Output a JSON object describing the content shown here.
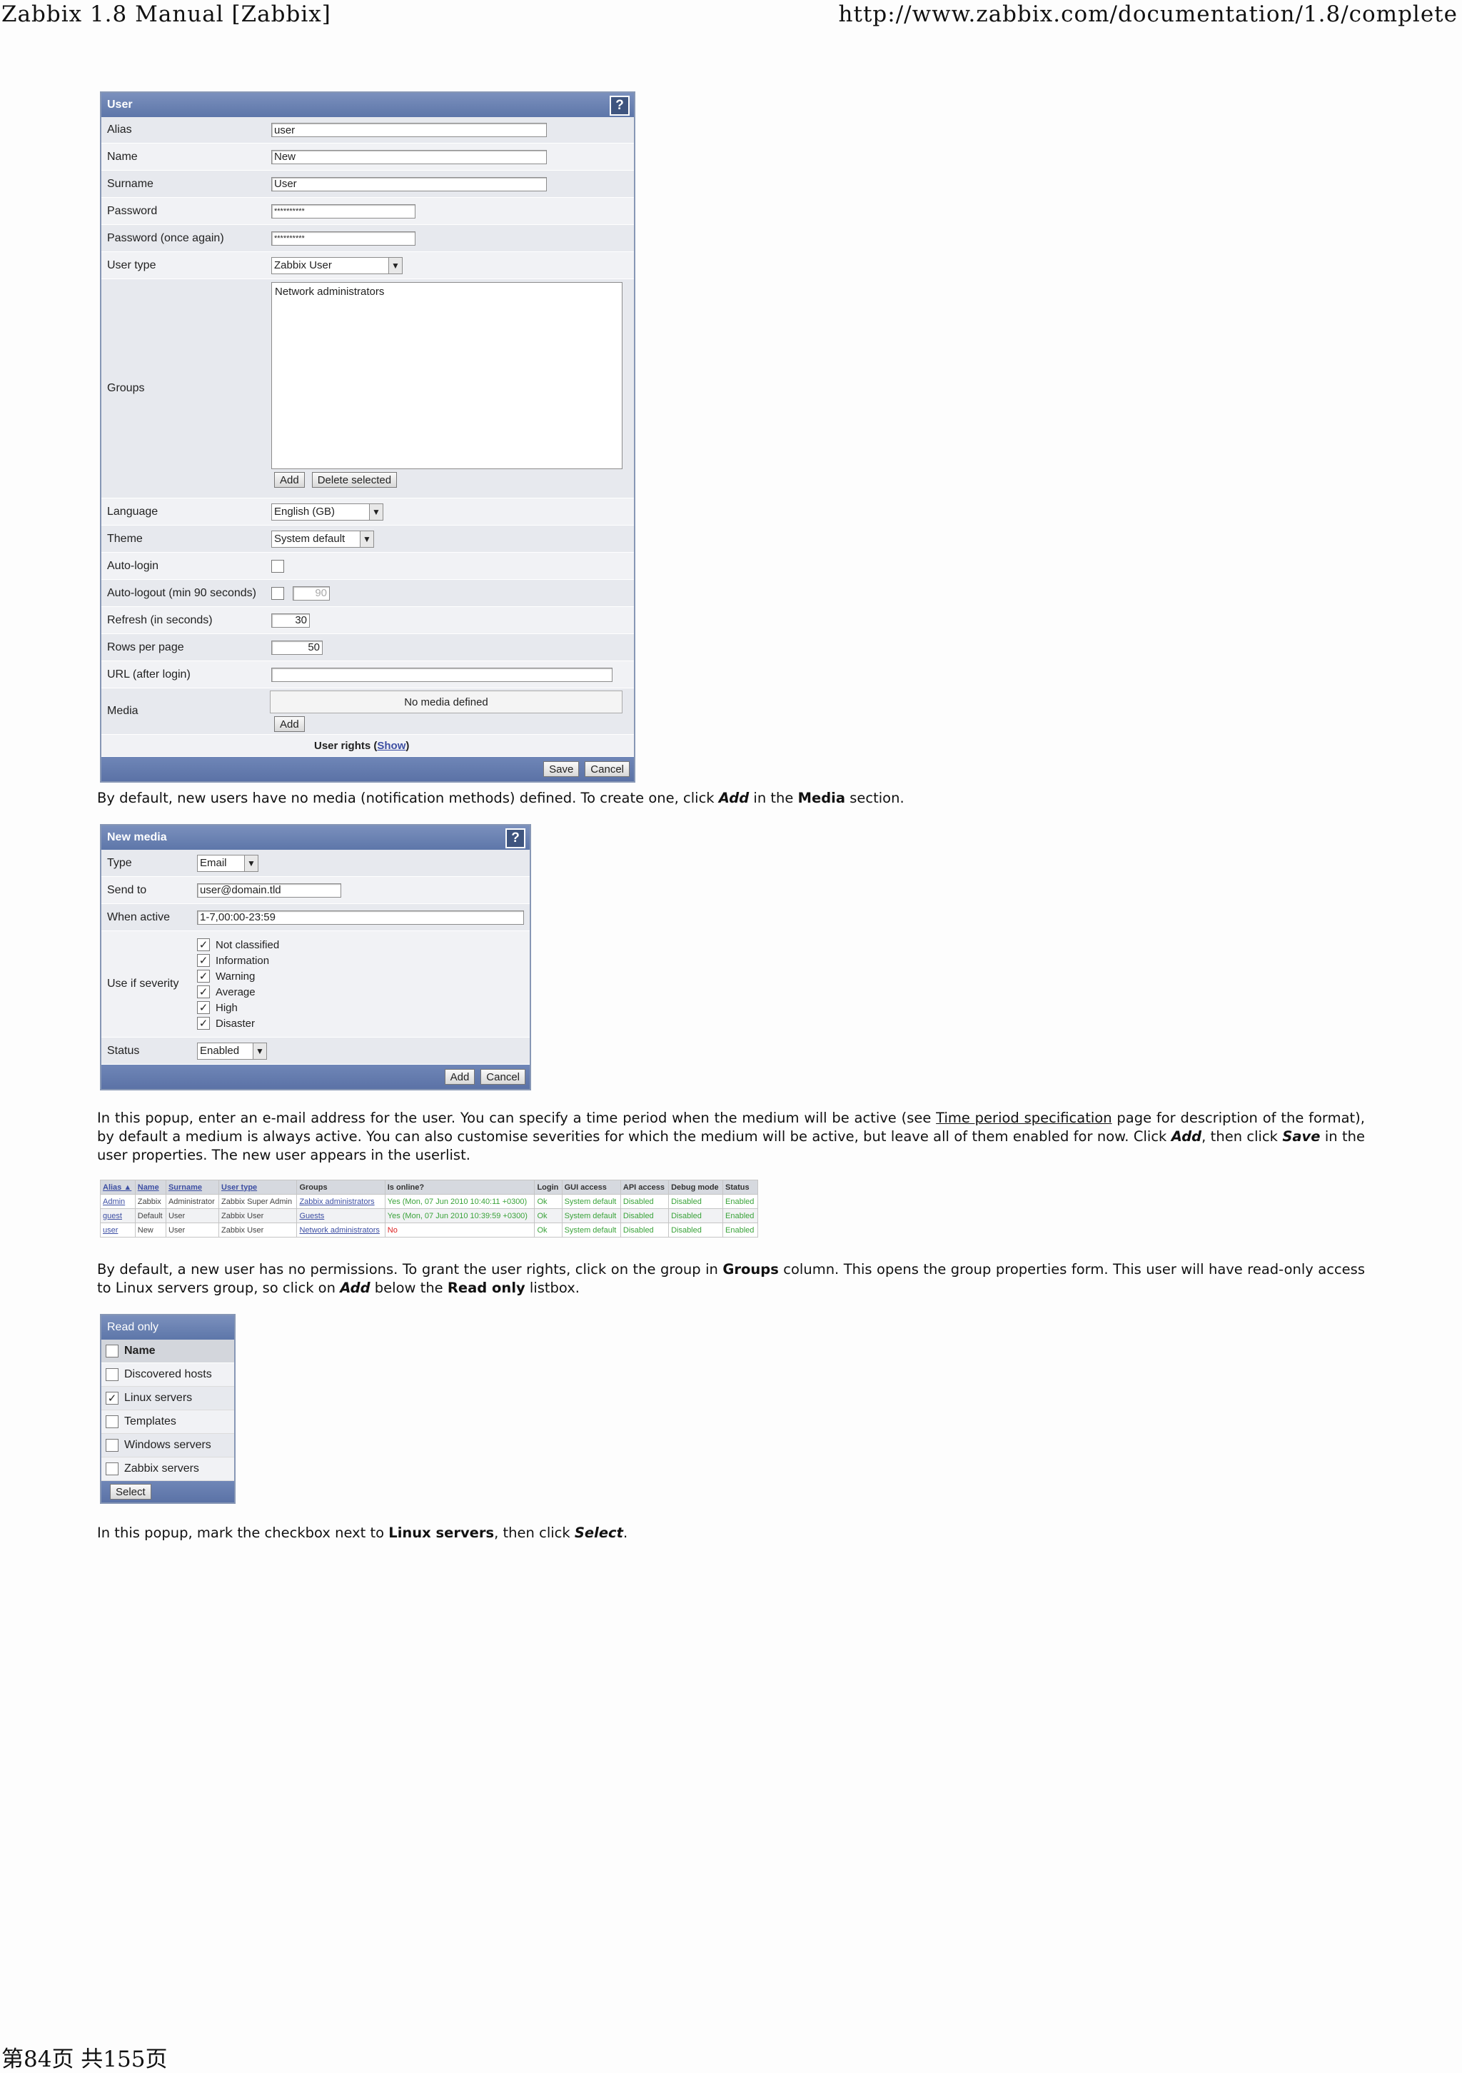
{
  "header": {
    "left": "Zabbix 1.8 Manual [Zabbix]",
    "right": "http://www.zabbix.com/documentation/1.8/complete"
  },
  "footer": "第84页 共155页",
  "user_form": {
    "title": "User",
    "alias_label": "Alias",
    "alias_value": "user",
    "name_label": "Name",
    "name_value": "New",
    "surname_label": "Surname",
    "surname_value": "User",
    "password_label": "Password",
    "password_value": "**********",
    "password2_label": "Password (once again)",
    "password2_value": "**********",
    "usertype_label": "User type",
    "usertype_value": "Zabbix User",
    "groups_label": "Groups",
    "groups_items": [
      "Network administrators"
    ],
    "add_btn": "Add",
    "delete_btn": "Delete selected",
    "language_label": "Language",
    "language_value": "English (GB)",
    "theme_label": "Theme",
    "theme_value": "System default",
    "autologin_label": "Auto-login",
    "autologout_label": "Auto-logout (min 90 seconds)",
    "autologout_value": "90",
    "refresh_label": "Refresh (in seconds)",
    "refresh_value": "30",
    "rows_label": "Rows per page",
    "rows_value": "50",
    "url_label": "URL (after login)",
    "url_value": "",
    "media_label": "Media",
    "media_none": "No media defined",
    "media_add": "Add",
    "rights_label": "User rights",
    "rights_link": "Show",
    "save_btn": "Save",
    "cancel_btn": "Cancel"
  },
  "para1": {
    "t1": "By default, new users have no media (notification methods) defined. To create one, click ",
    "b1": "Add",
    "t2": " in the ",
    "b2": "Media",
    "t3": " section."
  },
  "media_form": {
    "title": "New media",
    "type_label": "Type",
    "type_value": "Email",
    "sendto_label": "Send to",
    "sendto_value": "user@domain.tld",
    "active_label": "When active",
    "active_value": "1-7,00:00-23:59",
    "severity_label": "Use if severity",
    "severities": [
      "Not classified",
      "Information",
      "Warning",
      "Average",
      "High",
      "Disaster"
    ],
    "status_label": "Status",
    "status_value": "Enabled",
    "add_btn": "Add",
    "cancel_btn": "Cancel"
  },
  "para2": {
    "t1": "In this popup, enter an e-mail address for the user. You can specify a time period when the medium will be active (see ",
    "link": "Time period specification",
    "t2": " page for description of the format), by default a medium is always active. You can also customise severities for which the medium will be active, but leave all of them enabled for now. Click ",
    "b1": "Add",
    "t3": ", then click ",
    "b2": "Save",
    "t4": " in the user properties. The new user appears in the userlist."
  },
  "users_table": {
    "headers": [
      "Alias ▲",
      "Name",
      "Surname",
      "User type",
      "Groups",
      "Is online?",
      "Login",
      "GUI access",
      "API access",
      "Debug mode",
      "Status"
    ],
    "rows": [
      [
        "Admin",
        "Zabbix",
        "Administrator",
        "Zabbix Super Admin",
        "Zabbix administrators",
        "Yes (Mon, 07 Jun 2010 10:40:11 +0300)",
        "Ok",
        "System default",
        "Disabled",
        "Disabled",
        "Enabled"
      ],
      [
        "guest",
        "Default",
        "User",
        "Zabbix User",
        "Guests",
        "Yes (Mon, 07 Jun 2010 10:39:59 +0300)",
        "Ok",
        "System default",
        "Disabled",
        "Disabled",
        "Enabled"
      ],
      [
        "user",
        "New",
        "User",
        "Zabbix User",
        "Network administrators",
        "No",
        "Ok",
        "System default",
        "Disabled",
        "Disabled",
        "Enabled"
      ]
    ]
  },
  "para3": {
    "t1": "By default, a new user has no permissions. To grant the user rights, click on the group in ",
    "b1": "Groups",
    "t2": " column. This opens the group properties form. This user will have read-only access to Linux servers group, so click on ",
    "b2": "Add",
    "t3": " below the ",
    "b3": "Read only",
    "t4": " listbox."
  },
  "readonly_form": {
    "title": "Read only",
    "name_header": "Name",
    "items": [
      {
        "label": "Discovered hosts",
        "checked": false
      },
      {
        "label": "Linux servers",
        "checked": true
      },
      {
        "label": "Templates",
        "checked": false
      },
      {
        "label": "Windows servers",
        "checked": false
      },
      {
        "label": "Zabbix servers",
        "checked": false
      }
    ],
    "select_btn": "Select"
  },
  "para4": {
    "t1": "In this popup, mark the checkbox next to ",
    "b1": "Linux servers",
    "t2": ", then click ",
    "b2": "Select",
    "t3": "."
  }
}
